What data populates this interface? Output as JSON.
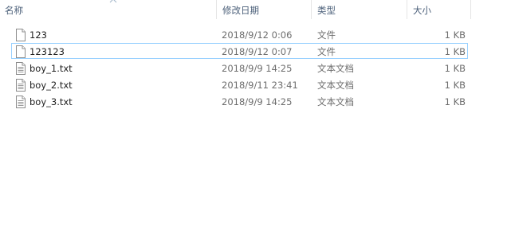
{
  "columns": {
    "name": "名称",
    "date": "修改日期",
    "type": "类型",
    "size": "大小"
  },
  "files": [
    {
      "name": "123",
      "date": "2018/9/12 0:06",
      "type": "文件",
      "size": "1 KB",
      "icon": "blank-file-icon"
    },
    {
      "name": "123123",
      "date": "2018/9/12 0:07",
      "type": "文件",
      "size": "1 KB",
      "icon": "blank-file-icon",
      "focused": true
    },
    {
      "name": "boy_1.txt",
      "date": "2018/9/9 14:25",
      "type": "文本文档",
      "size": "1 KB",
      "icon": "text-file-icon"
    },
    {
      "name": "boy_2.txt",
      "date": "2018/9/11 23:41",
      "type": "文本文档",
      "size": "1 KB",
      "icon": "text-file-icon"
    },
    {
      "name": "boy_3.txt",
      "date": "2018/9/9 14:25",
      "type": "文本文档",
      "size": "1 KB",
      "icon": "text-file-icon"
    }
  ],
  "colors": {
    "header_text": "#4c607a",
    "focus_border": "#99d1ff",
    "secondary_text": "#6d6d6d"
  }
}
